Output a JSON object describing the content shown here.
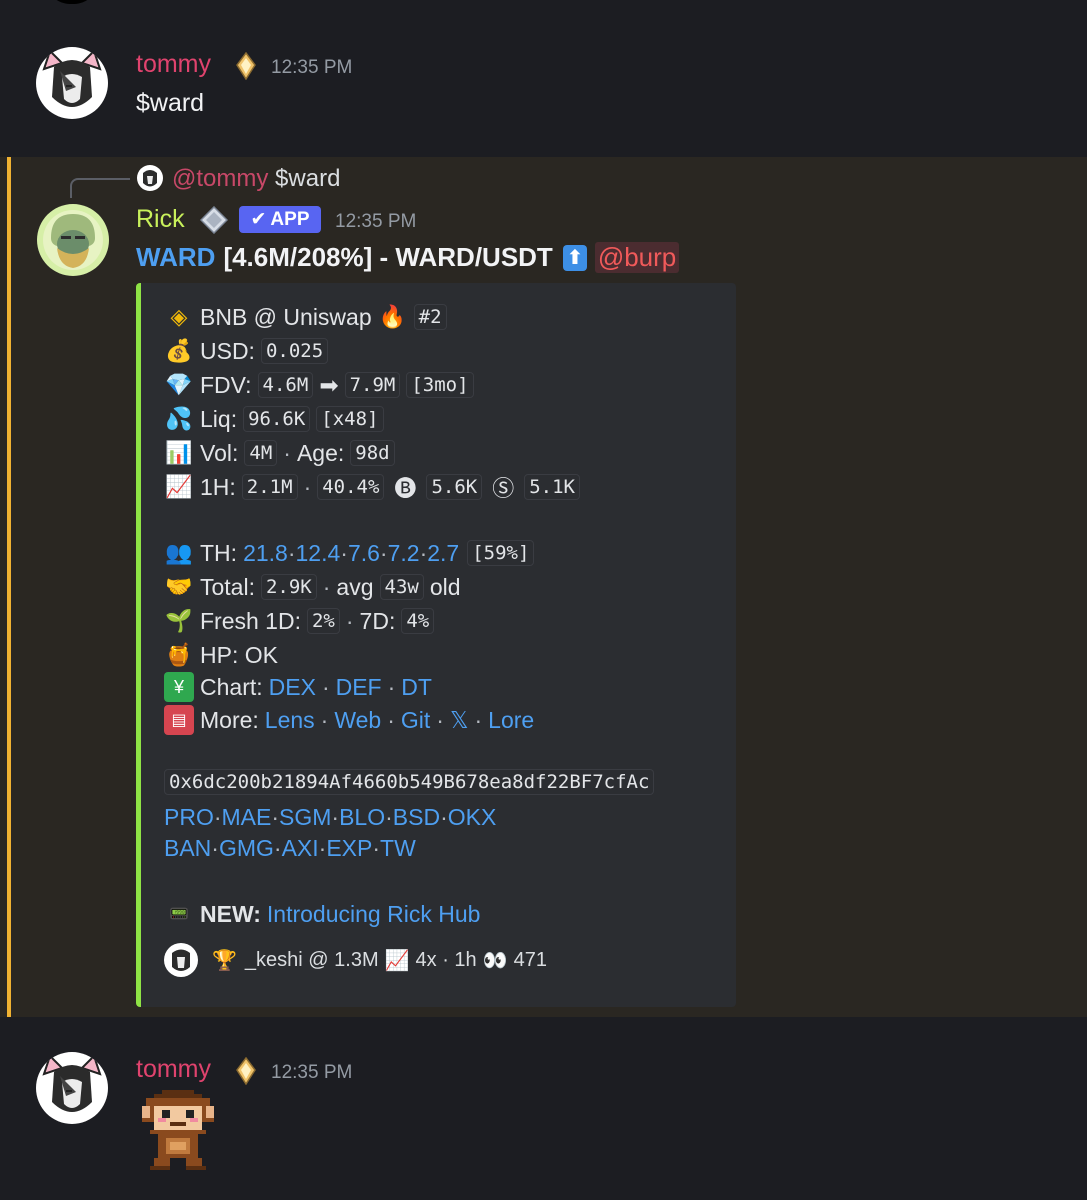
{
  "colors": {
    "bg": "#1c1d22",
    "highlight_bg": "#2a2722",
    "highlight_bar": "#f0b232",
    "embed_bg": "#2b2d31",
    "embed_bar": "#8fe345",
    "tommy_color": "#e0436e",
    "rick_color": "#c8f05b",
    "link": "#4e9ff1",
    "app_badge": "#5865f2",
    "mention_bg": "#4b2c30",
    "mention_text": "#f05a5a"
  },
  "messages": [
    {
      "author": "tommy",
      "time": "12:35 PM",
      "text": "$ward"
    },
    {
      "author": "tommy",
      "time": "12:35 PM",
      "sticker": "pixel-monkey"
    }
  ],
  "reply": {
    "mention": "@tommy",
    "text": "$ward"
  },
  "rick": {
    "author": "Rick",
    "badge": "APP",
    "time": "12:35 PM",
    "title_token": "WARD",
    "title_rest": "[4.6M/208%] - WARD/USDT",
    "mention": "@burp"
  },
  "embed": {
    "chain_line": "BNB @ Uniswap",
    "rank": "#2",
    "usd_label": "USD:",
    "usd": "0.025",
    "fdv_label": "FDV:",
    "fdv_from": "4.6M",
    "fdv_to": "7.9M",
    "fdv_period": "[3mo]",
    "liq_label": "Liq:",
    "liq": "96.6K",
    "liq_mult": "[x48]",
    "vol_label": "Vol:",
    "vol": "4M",
    "age_label": "Age:",
    "age": "98d",
    "h1_label": "1H:",
    "h1_vol": "2.1M",
    "h1_change": "40.4%",
    "buy": "5.6K",
    "sell": "5.1K",
    "th_label": "TH:",
    "th_values": [
      "21.8",
      "12.4",
      "7.6",
      "7.2",
      "2.7"
    ],
    "th_total": "[59%]",
    "total_label": "Total:",
    "total": "2.9K",
    "avg_label": "avg",
    "avg": "43w",
    "old_label": "old",
    "fresh_label": "Fresh 1D:",
    "fresh_1d": "2%",
    "fresh_7d_label": "7D:",
    "fresh_7d": "4%",
    "hp_line": "HP: OK",
    "chart_label": "Chart:",
    "chart_links": [
      "DEX",
      "DEF",
      "DT"
    ],
    "more_label": "More:",
    "more_links": [
      "Lens",
      "Web",
      "Git",
      "𝕏",
      "Lore"
    ],
    "address": "0x6dc200b21894Af4660b549B678ea8df22BF7cfAc",
    "bots_row1": [
      "PRO",
      "MAE",
      "SGM",
      "BLO",
      "BSD",
      "OKX"
    ],
    "bots_row2": [
      "BAN",
      "GMG",
      "AXI",
      "EXP",
      "TW"
    ],
    "new_label": "NEW:",
    "new_link": "Introducing Rick Hub",
    "footer": "_keshi @ 1.3M",
    "footer_stats": "4x · 1h",
    "footer_views": "471"
  }
}
